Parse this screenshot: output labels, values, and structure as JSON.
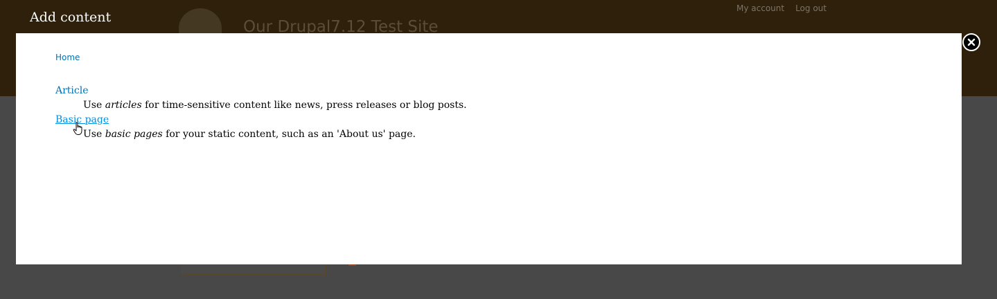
{
  "background": {
    "site_name": "Our Drupal7.12 Test Site",
    "my_account_label": "My account",
    "logout_label": "Log out"
  },
  "overlay": {
    "title": "Add content",
    "breadcrumb": "Home",
    "content_types": [
      {
        "name": "Article",
        "description_pre": "Use ",
        "description_em": "articles",
        "description_post": " for time-sensitive content like news, press releases or blog posts."
      },
      {
        "name": "Basic page",
        "description_pre": "Use ",
        "description_em": "basic pages",
        "description_post": " for your static content, such as an 'About us' page."
      }
    ]
  },
  "colors": {
    "link": "#0071b3",
    "link_hover": "#018fe2",
    "header_bg": "#2e200b",
    "dim_bg": "#484848"
  }
}
